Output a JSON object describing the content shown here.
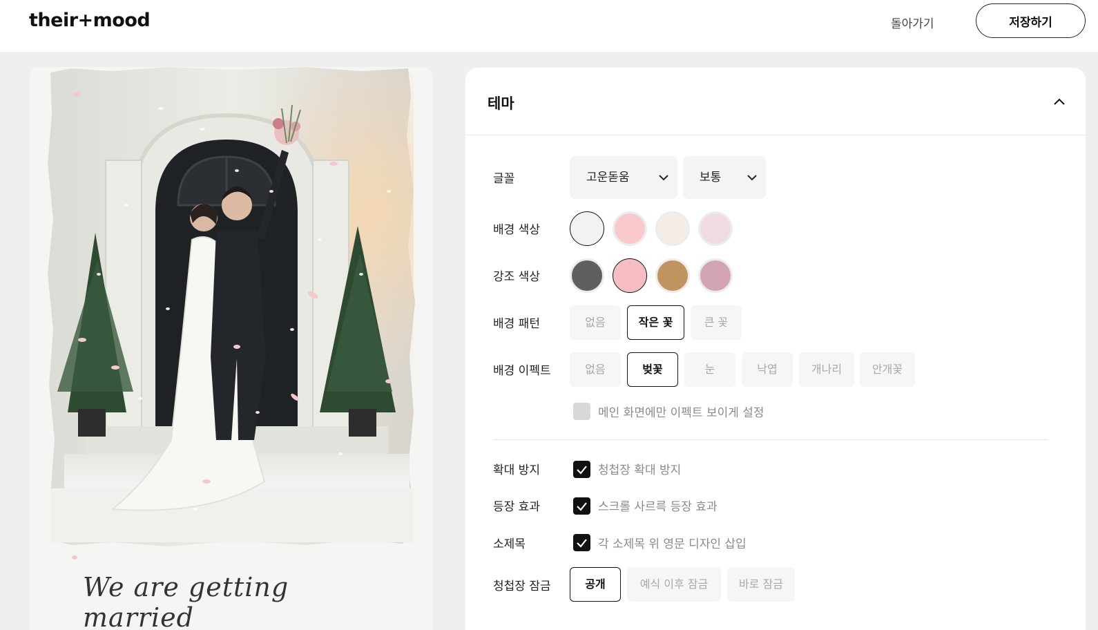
{
  "header": {
    "logo": "their+mood",
    "back_label": "돌아가기",
    "save_label": "저장하기"
  },
  "preview": {
    "script_text": "We are getting married"
  },
  "theme": {
    "title": "테마",
    "font": {
      "label": "글꼴",
      "family_value": "고운돋움",
      "weight_value": "보통"
    },
    "background_color": {
      "label": "배경 색상",
      "swatches": [
        "#f2f2f2",
        "#f9c9cc",
        "#f3ede5",
        "#f0dbe2"
      ],
      "selected_index": 0
    },
    "accent_color": {
      "label": "강조 색상",
      "swatches": [
        "#5f5f5f",
        "#f6bec1",
        "#c0935f",
        "#d3a4b4"
      ],
      "selected_index": 1
    },
    "background_pattern": {
      "label": "배경 패턴",
      "options": [
        "없음",
        "작은 꽃",
        "큰 꽃"
      ],
      "selected": "작은 꽃"
    },
    "background_effect": {
      "label": "배경 이펙트",
      "options": [
        "없음",
        "벚꽃",
        "눈",
        "낙엽",
        "개나리",
        "안개꽃"
      ],
      "selected": "벚꽃",
      "main_only_label": "메인 화면에만 이펙트 보이게 설정",
      "main_only_checked": false
    },
    "zoom_lock": {
      "label": "확대 방지",
      "text": "청첩장 확대 방지",
      "checked": true
    },
    "appear_effect": {
      "label": "등장 효과",
      "text": "스크롤 사르륵 등장 효과",
      "checked": true
    },
    "subtitle": {
      "label": "소제목",
      "text": "각 소제목 위 영문 디자인 삽입",
      "checked": true
    },
    "lock": {
      "label": "청첩장 잠금",
      "options": [
        "공개",
        "예식 이후 잠금",
        "바로 잠금"
      ],
      "selected": "공개"
    }
  }
}
